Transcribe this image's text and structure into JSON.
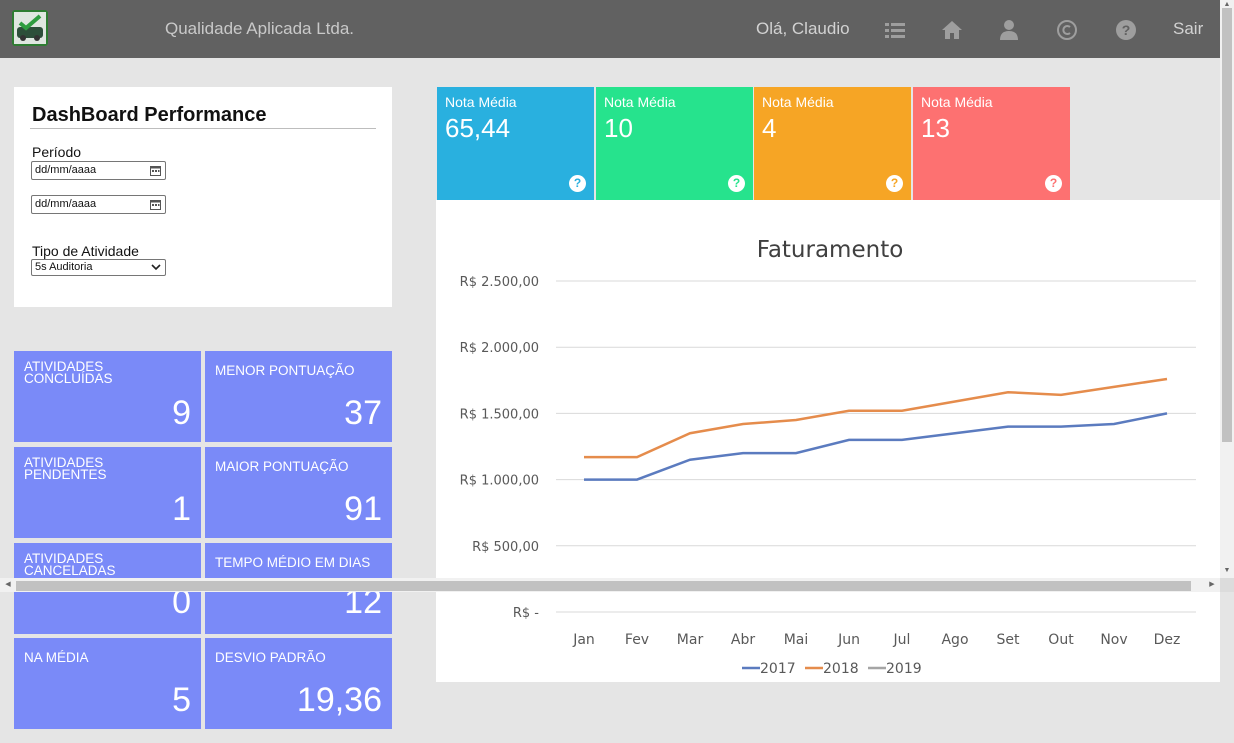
{
  "header": {
    "company": "Qualidade Aplicada Ltda.",
    "greeting": "Olá, Claudio",
    "logout": "Sair",
    "nav_icons": [
      "list-icon",
      "home-icon",
      "user-icon",
      "copyright-icon",
      "help-icon"
    ],
    "bar_color": "#616161"
  },
  "filters": {
    "title": "DashBoard Performance",
    "period_label": "Período",
    "date_start": "dd/mm/aaaa",
    "date_end": "dd/mm/aaaa",
    "activity_label": "Tipo de Atividade",
    "activity_value": "5s Auditoria"
  },
  "notas": [
    {
      "label": "Nota Média",
      "value": "65,44",
      "color": "#29b0df"
    },
    {
      "label": "Nota Média",
      "value": "10",
      "color": "#26e38d"
    },
    {
      "label": "Nota Média",
      "value": "4",
      "color": "#f6a525"
    },
    {
      "label": "Nota Média",
      "value": "13",
      "color": "#fd7171"
    }
  ],
  "tiles": [
    {
      "label": "ATIVIDADES CONCLUÍDAS",
      "value": "9"
    },
    {
      "label": "MENOR PONTUAÇÃO",
      "value": "37"
    },
    {
      "label": "ATIVIDADES PENDENTES",
      "value": "1"
    },
    {
      "label": "MAIOR PONTUAÇÃO",
      "value": "91"
    },
    {
      "label": "ATIVIDADES CANCELADAS",
      "value": "0"
    },
    {
      "label": "TEMPO MÉDIO EM DIAS",
      "value": "12"
    },
    {
      "label": "NA MÉDIA",
      "value": "5"
    },
    {
      "label": "DESVIO PADRÃO",
      "value": "19,36"
    }
  ],
  "tile_color": "#7a8af8",
  "chart_data": {
    "type": "line",
    "title": "Faturamento",
    "categories": [
      "Jan",
      "Fev",
      "Mar",
      "Abr",
      "Mai",
      "Jun",
      "Jul",
      "Ago",
      "Set",
      "Out",
      "Nov",
      "Dez"
    ],
    "y_ticks": [
      {
        "value": 2500,
        "label": "R$ 2.500,00"
      },
      {
        "value": 2000,
        "label": "R$ 2.000,00"
      },
      {
        "value": 1500,
        "label": "R$ 1.500,00"
      },
      {
        "value": 1000,
        "label": "R$ 1.000,00"
      },
      {
        "value": 500,
        "label": "R$ 500,00"
      },
      {
        "value": 0,
        "label": "R$ -"
      }
    ],
    "ylim": [
      0,
      2500
    ],
    "grid": true,
    "legend": "bottom",
    "series": [
      {
        "name": "2017",
        "color": "#5b7bbf",
        "values": [
          1000,
          1000,
          1150,
          1200,
          1200,
          1300,
          1300,
          1350,
          1400,
          1400,
          1420,
          1500
        ]
      },
      {
        "name": "2018",
        "color": "#e58c4c",
        "values": [
          1170,
          1170,
          1350,
          1420,
          1450,
          1520,
          1520,
          1590,
          1660,
          1640,
          1700,
          1760
        ]
      },
      {
        "name": "2019",
        "color": "#a5a5a5",
        "values": []
      }
    ]
  }
}
